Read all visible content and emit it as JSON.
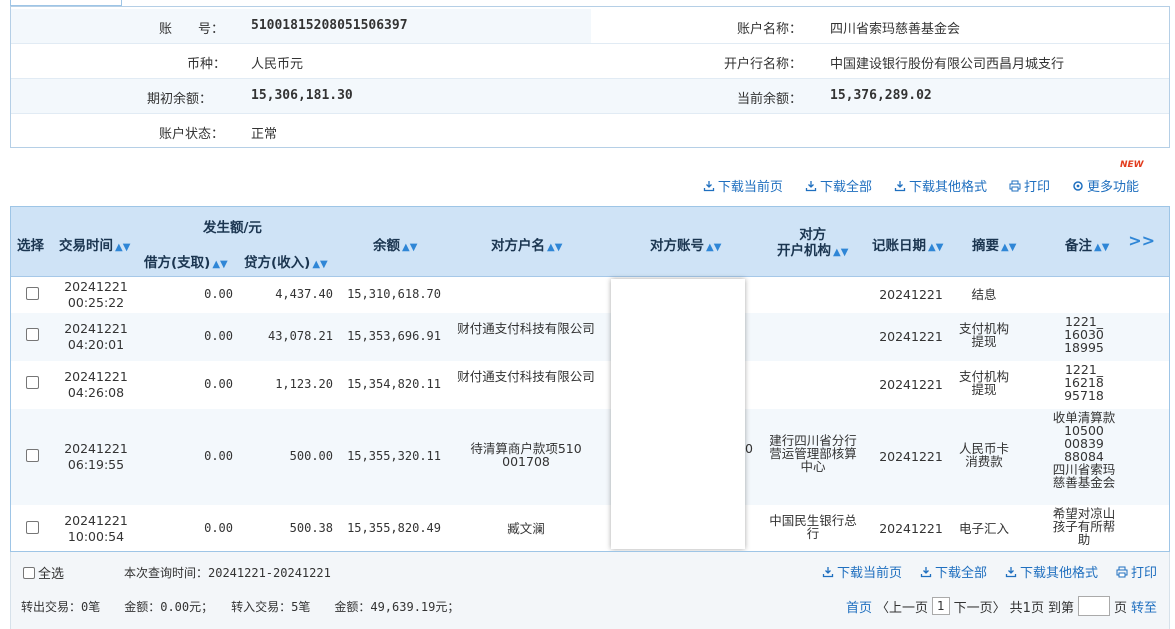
{
  "account": {
    "no_label": "账　　号：",
    "no_value": "51001815208051506397",
    "name_label": "账户名称：",
    "name_value": "四川省索玛慈善基金会",
    "currency_label": "币种：",
    "currency_value": "人民币元",
    "bank_label": "开户行名称：",
    "bank_value": "中国建设银行股份有限公司西昌月城支行",
    "opening_label": "期初余额：",
    "opening_value": "15,306,181.30",
    "current_label": "当前余额：",
    "current_value": "15,376,289.02",
    "status_label": "账户状态：",
    "status_value": "正常"
  },
  "toolbar": {
    "download_page": "下载当前页",
    "download_all": "下载全部",
    "download_other": "下载其他格式",
    "print": "打印",
    "more": "更多功能",
    "new_badge": "NEW"
  },
  "table": {
    "headers": {
      "select": "选择",
      "time": "交易时间",
      "amount_group": "发生额/元",
      "debit": "借方(支取)",
      "credit": "贷方(收入)",
      "balance": "余额",
      "party_name": "对方户名",
      "party_account": "对方账号",
      "party_bank": "对方\n开户机构",
      "book_date": "记账日期",
      "summary": "摘要",
      "remark": "备注",
      "more": ">>"
    },
    "rows": [
      {
        "date": "20241221",
        "time": "00:25:22",
        "debit": "0.00",
        "credit": "4,437.40",
        "balance": "15,310,618.70",
        "name": "",
        "bank": "",
        "book": "20241221",
        "summary": "结息",
        "remark": ""
      },
      {
        "date": "20241221",
        "time": "04:20:01",
        "debit": "0.00",
        "credit": "43,078.21",
        "balance": "15,353,696.91",
        "name": "财付通支付科技有限公司",
        "bank": "",
        "book": "20241221",
        "summary": "支付机构提现",
        "remark": "1221_\n16030\n18995"
      },
      {
        "date": "20241221",
        "time": "04:26:08",
        "debit": "0.00",
        "credit": "1,123.20",
        "balance": "15,354,820.11",
        "name": "财付通支付科技有限公司",
        "bank": "",
        "book": "20241221",
        "summary": "支付机构提现",
        "remark": "1221_\n16218\n95718"
      },
      {
        "date": "20241221",
        "time": "06:19:55",
        "debit": "0.00",
        "credit": "500.00",
        "balance": "15,355,320.11",
        "name": "待清算商户款项510\n001708",
        "bank": "建行四川省分行营运管理部核算中心",
        "book": "20241221",
        "summary": "人民币卡消费款",
        "remark": "收单清算款\n10500\n00839\n88084\n四川省索玛\n慈善基金会"
      },
      {
        "date": "20241221",
        "time": "10:00:54",
        "debit": "0.00",
        "credit": "500.38",
        "balance": "15,355,820.49",
        "name": "臧文澜",
        "bank": "中国民生银行总行",
        "book": "20241221",
        "summary": "电子汇入",
        "remark": "希望对凉山\n孩子有所帮\n助"
      }
    ],
    "partial_account_digit": "0"
  },
  "footer": {
    "select_all": "全选",
    "query_time": "本次查询时间：20241221-20241221",
    "download_page": "下载当前页",
    "download_all": "下载全部",
    "download_other": "下载其他格式",
    "print": "打印",
    "summary": "转出交易：0笔　　金额：0.00元；　　转入交易：5笔　　金额：49,639.19元；",
    "first": "首页",
    "prev": "〈上一页",
    "page": "1",
    "next": "下一页〉",
    "total": "共1页",
    "goto": "到第",
    "page_unit": "页",
    "go": "转至"
  }
}
